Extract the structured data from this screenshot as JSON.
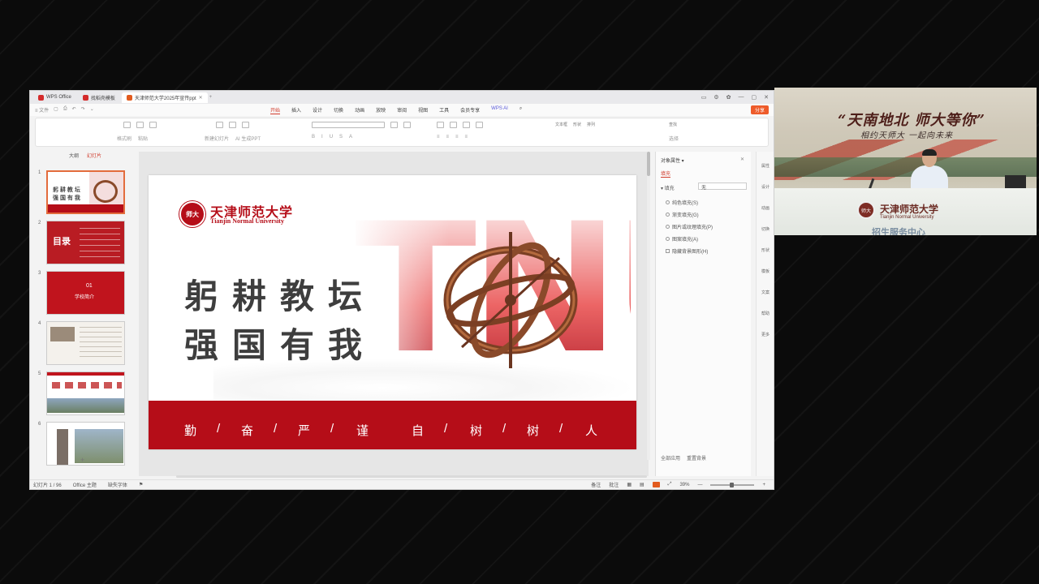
{
  "window": {
    "tabs": [
      {
        "label": "WPS Office"
      },
      {
        "label": "找稻壳模板"
      },
      {
        "label": "天津师范大学2025年宣传ppt"
      }
    ],
    "controls": [
      "▭",
      "⚙",
      "✿",
      "—",
      "▢",
      "✕"
    ]
  },
  "menubar": {
    "file_label": "≡ 文件",
    "items": [
      "开始",
      "插入",
      "设计",
      "切换",
      "动画",
      "放映",
      "审阅",
      "视图",
      "工具",
      "会员专享",
      "WPS AI"
    ],
    "share_label": "分享"
  },
  "ribbon": {
    "labels": [
      "格式刷",
      "粘贴",
      "新建幻灯片",
      "版式",
      "节",
      "重置",
      "AI 生成PPT",
      "当前页",
      "文本框",
      "形状",
      "排列",
      "查找",
      "选择"
    ]
  },
  "left_panel": {
    "tabs": [
      "大纲",
      "幻灯片"
    ],
    "slide_numbers": [
      "1",
      "2",
      "3",
      "4",
      "5",
      "6"
    ],
    "thumb1_text": "躬 耕 教 坛\n强 国 有 我",
    "thumb2_text": "目录",
    "thumb3_num": "01",
    "thumb3_text": "学校简介",
    "add_label": "+"
  },
  "slide": {
    "crest_text": "师大",
    "university_cn": "天津师范大学",
    "university_en": "Tianjin Normal University",
    "big_letters": "TNU",
    "headline_line1": "躬耕教坛",
    "headline_line2": "强国有我",
    "motto": [
      "勤",
      "/",
      "奋",
      "/",
      "严",
      "/",
      "谨",
      "自",
      "/",
      "树",
      "/",
      "树",
      "/",
      "人"
    ]
  },
  "right_pane": {
    "title": "对象属性 ▾",
    "tab": "填充",
    "fill_label": "▾ 填充",
    "fill_value": "无",
    "options": [
      "纯色填充(S)",
      "渐变填充(G)",
      "图片或纹理填充(P)",
      "图案填充(A)",
      "隐藏背景图形(H)"
    ],
    "footer": [
      "全部应用",
      "重置背景"
    ]
  },
  "side_icons": [
    "属性",
    "设计",
    "动画",
    "切换",
    "形状",
    "模板",
    "文案",
    "帮助",
    "更多"
  ],
  "statusbar": {
    "page": "幻灯片 1 / 96",
    "theme": "Office 主题",
    "font": "缺失字体",
    "notes": "备注",
    "comments": "批注",
    "zoom": "39%"
  },
  "video": {
    "banner_line1": "“天南地北 师大等你”",
    "banner_line2": "相约天师大 一起向未来",
    "desk_cn": "天津师范大学",
    "desk_en": "Tianjin Normal University",
    "desk_sub": "招生服务中心"
  },
  "colors": {
    "brand_red": "#b50d18",
    "wps_orange": "#e25b1e",
    "accent": "#d03a2b"
  }
}
